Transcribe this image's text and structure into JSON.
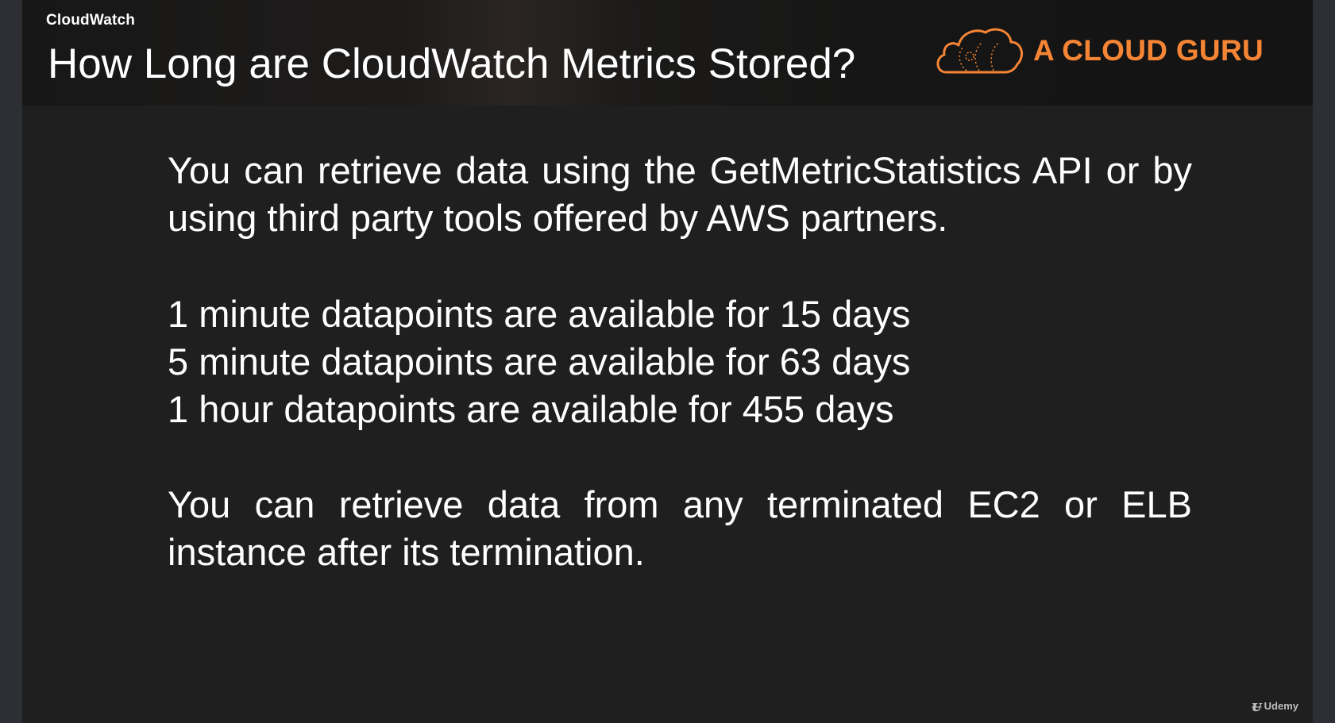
{
  "header": {
    "section_label": "CloudWatch",
    "title": "How Long are CloudWatch Metrics Stored?",
    "logo_text": "A CLOUD GURU"
  },
  "content": {
    "paragraph_1": "You can retrieve data using the GetMetricStatistics API or by using third party tools offered by AWS partners.",
    "retention_lines": [
      "1 minute datapoints are available for 15 days",
      "5 minute datapoints are available for 63 days",
      "1 hour datapoints are available for 455 days"
    ],
    "paragraph_3": "You can retrieve data from any terminated EC2 or ELB instance after its termination."
  },
  "watermark": {
    "label": "Udemy"
  },
  "colors": {
    "slide_background": "#1f1f1f",
    "frame_background": "#2d2f35",
    "brand_orange": "#f58535",
    "text": "#ffffff"
  },
  "icons": [
    "cloud-guru-logo-icon",
    "udemy-logo-icon"
  ]
}
